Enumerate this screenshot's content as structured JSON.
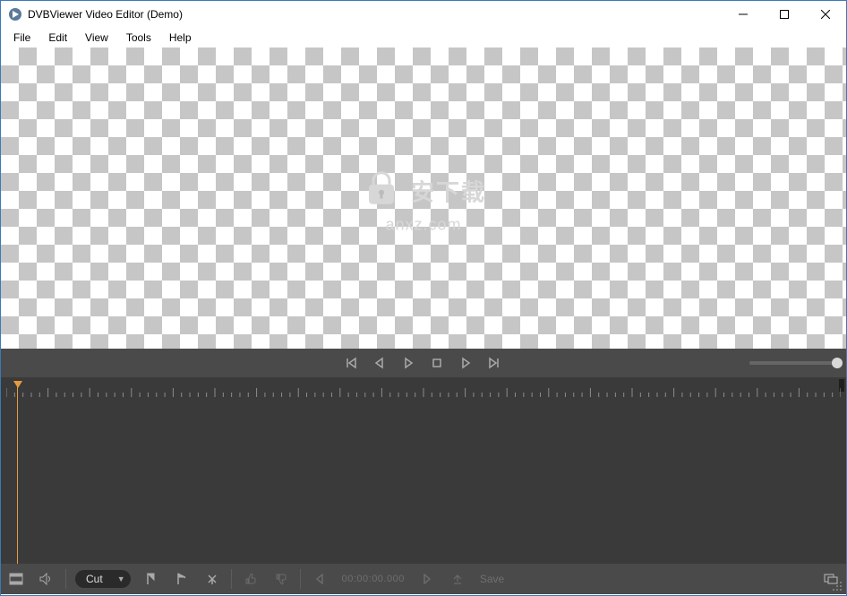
{
  "window": {
    "title": "DVBViewer Video Editor (Demo)"
  },
  "menu": {
    "items": [
      "File",
      "Edit",
      "View",
      "Tools",
      "Help"
    ]
  },
  "watermark": {
    "text": "安下载",
    "url": "anxz.com"
  },
  "transport": {
    "buttons": [
      "prev-keyframe",
      "step-back",
      "play",
      "stop",
      "step-fwd",
      "next-keyframe"
    ]
  },
  "bottombar": {
    "mode_label": "Cut",
    "timecode": "00:00:00.000",
    "save_label": "Save"
  }
}
